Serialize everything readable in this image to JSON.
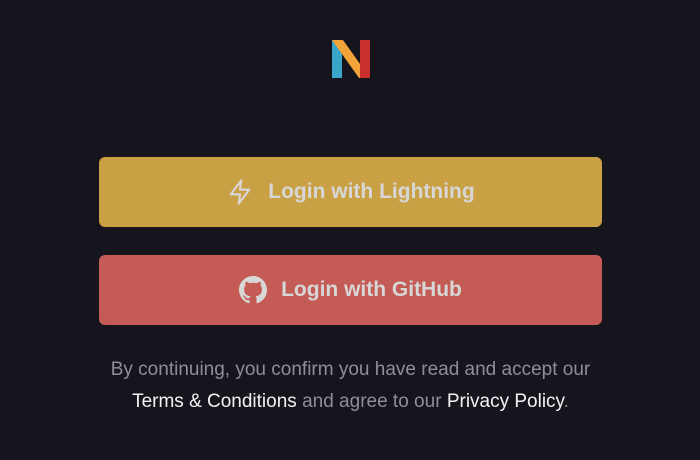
{
  "logo": {
    "name": "n-logo-icon",
    "colors": [
      "#3aa6c9",
      "#f2a33a",
      "#c9302c"
    ]
  },
  "buttons": {
    "lightning": {
      "label": "Login with Lightning",
      "icon": "lightning-bolt-icon",
      "color": "#c9a043"
    },
    "github": {
      "label": "Login with GitHub",
      "icon": "github-icon",
      "color": "#c45c55"
    }
  },
  "consent": {
    "prefix": "By continuing, you confirm you have read and accept our",
    "terms_link": "Terms & Conditions",
    "middle": "and agree to our",
    "privacy_link": "Privacy Policy",
    "suffix": "."
  }
}
